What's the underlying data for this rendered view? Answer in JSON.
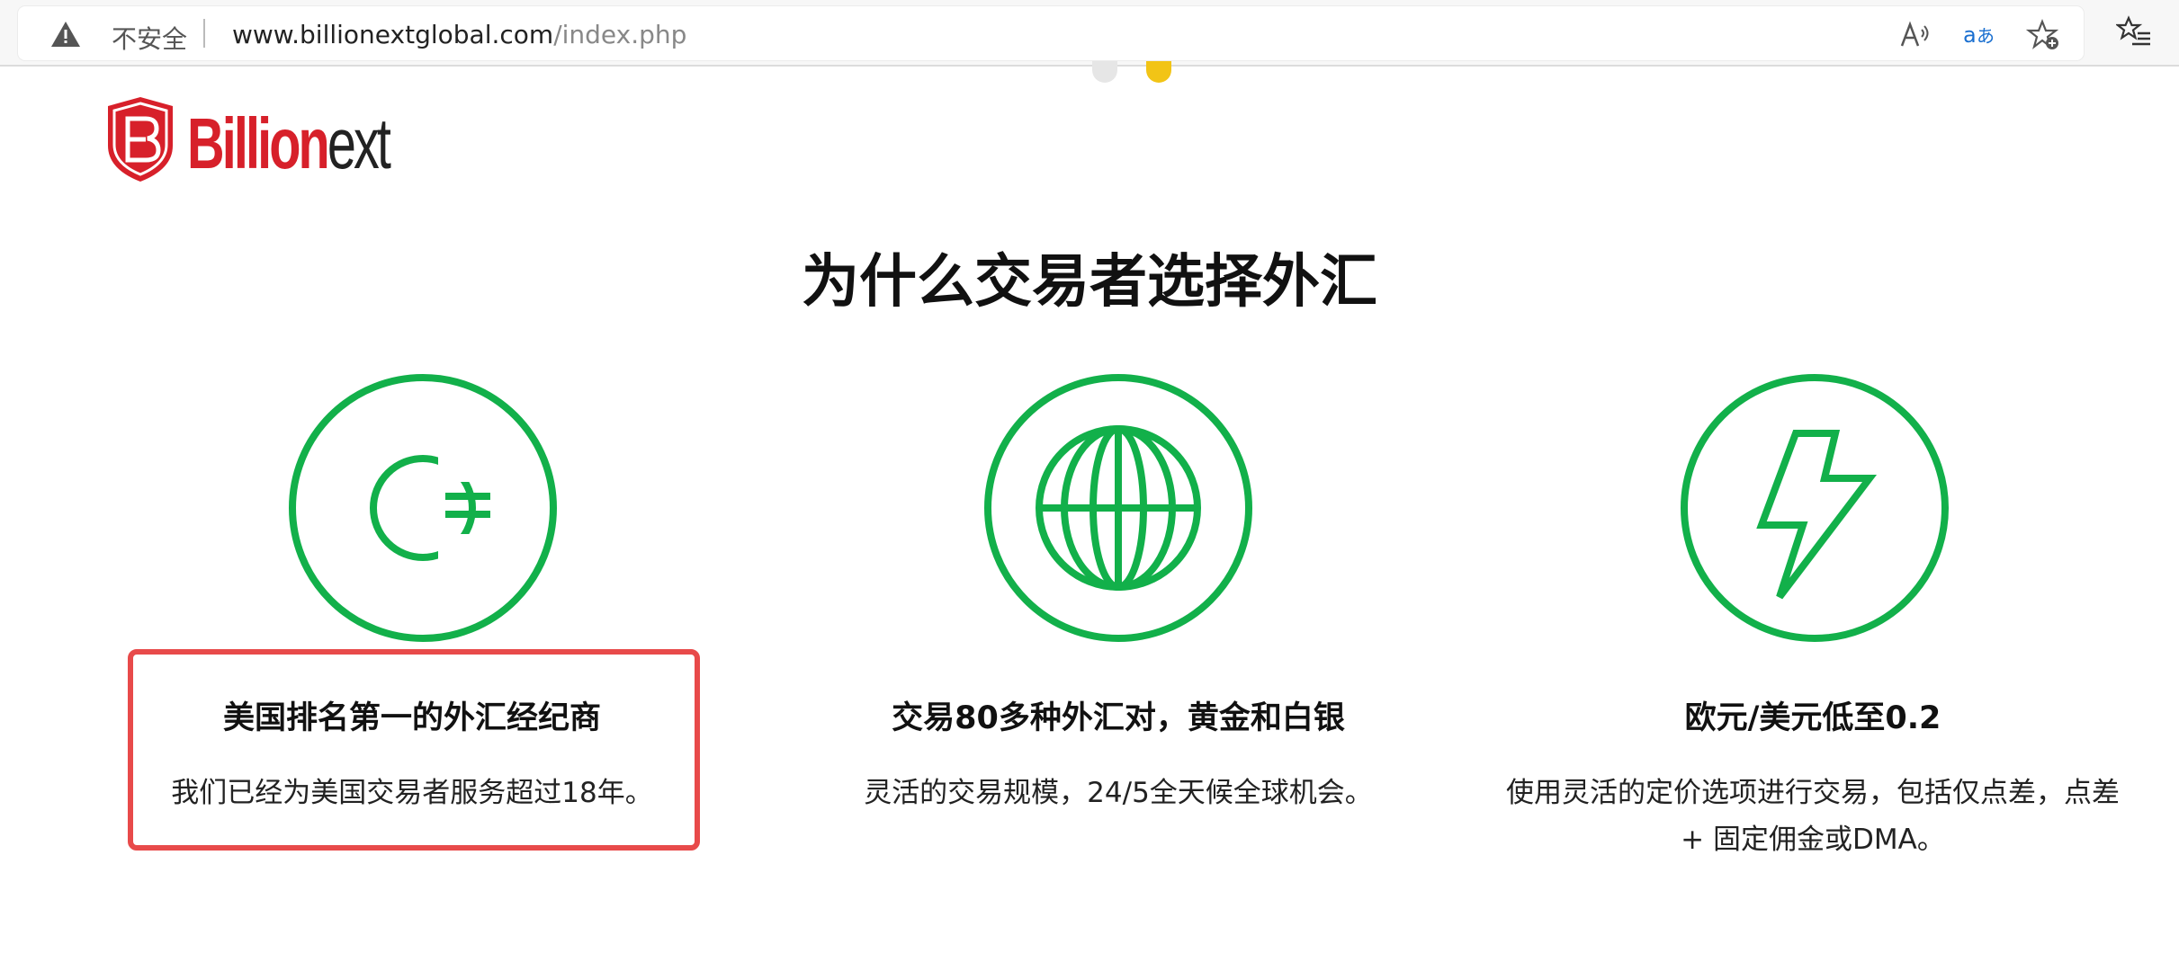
{
  "browser": {
    "security_label": "不安全",
    "url_domain": "www.billionextglobal.com",
    "url_path": "/index.php",
    "icons": [
      "warning-icon",
      "read-aloud-icon",
      "translate-icon",
      "add-favorite-icon",
      "favorites-icon"
    ]
  },
  "carousel": {
    "dots": 2,
    "active_dot": 2
  },
  "logo": {
    "part1": "Billion",
    "part2": "ext"
  },
  "headline": "为什么交易者选择外汇",
  "colors": {
    "accent_green": "#12b04a",
    "brand_red": "#d7202a",
    "highlight_red": "#e84a4a",
    "dot_active": "#f2c416"
  },
  "features": [
    {
      "icon": "currency-icon",
      "title": "美国排名第一的外汇经纪商",
      "desc": "我们已经为美国交易者服务超过18年。",
      "highlighted": true
    },
    {
      "icon": "globe-icon",
      "title": "交易80多种外汇对，黄金和白银",
      "desc": "灵活的交易规模，24/5全天候全球机会。",
      "highlighted": false
    },
    {
      "icon": "lightning-icon",
      "title": "欧元/美元低至0.2",
      "desc": "使用灵活的定价选项进行交易，包括仅点差，点差+ 固定佣金或DMA。",
      "highlighted": false
    }
  ]
}
